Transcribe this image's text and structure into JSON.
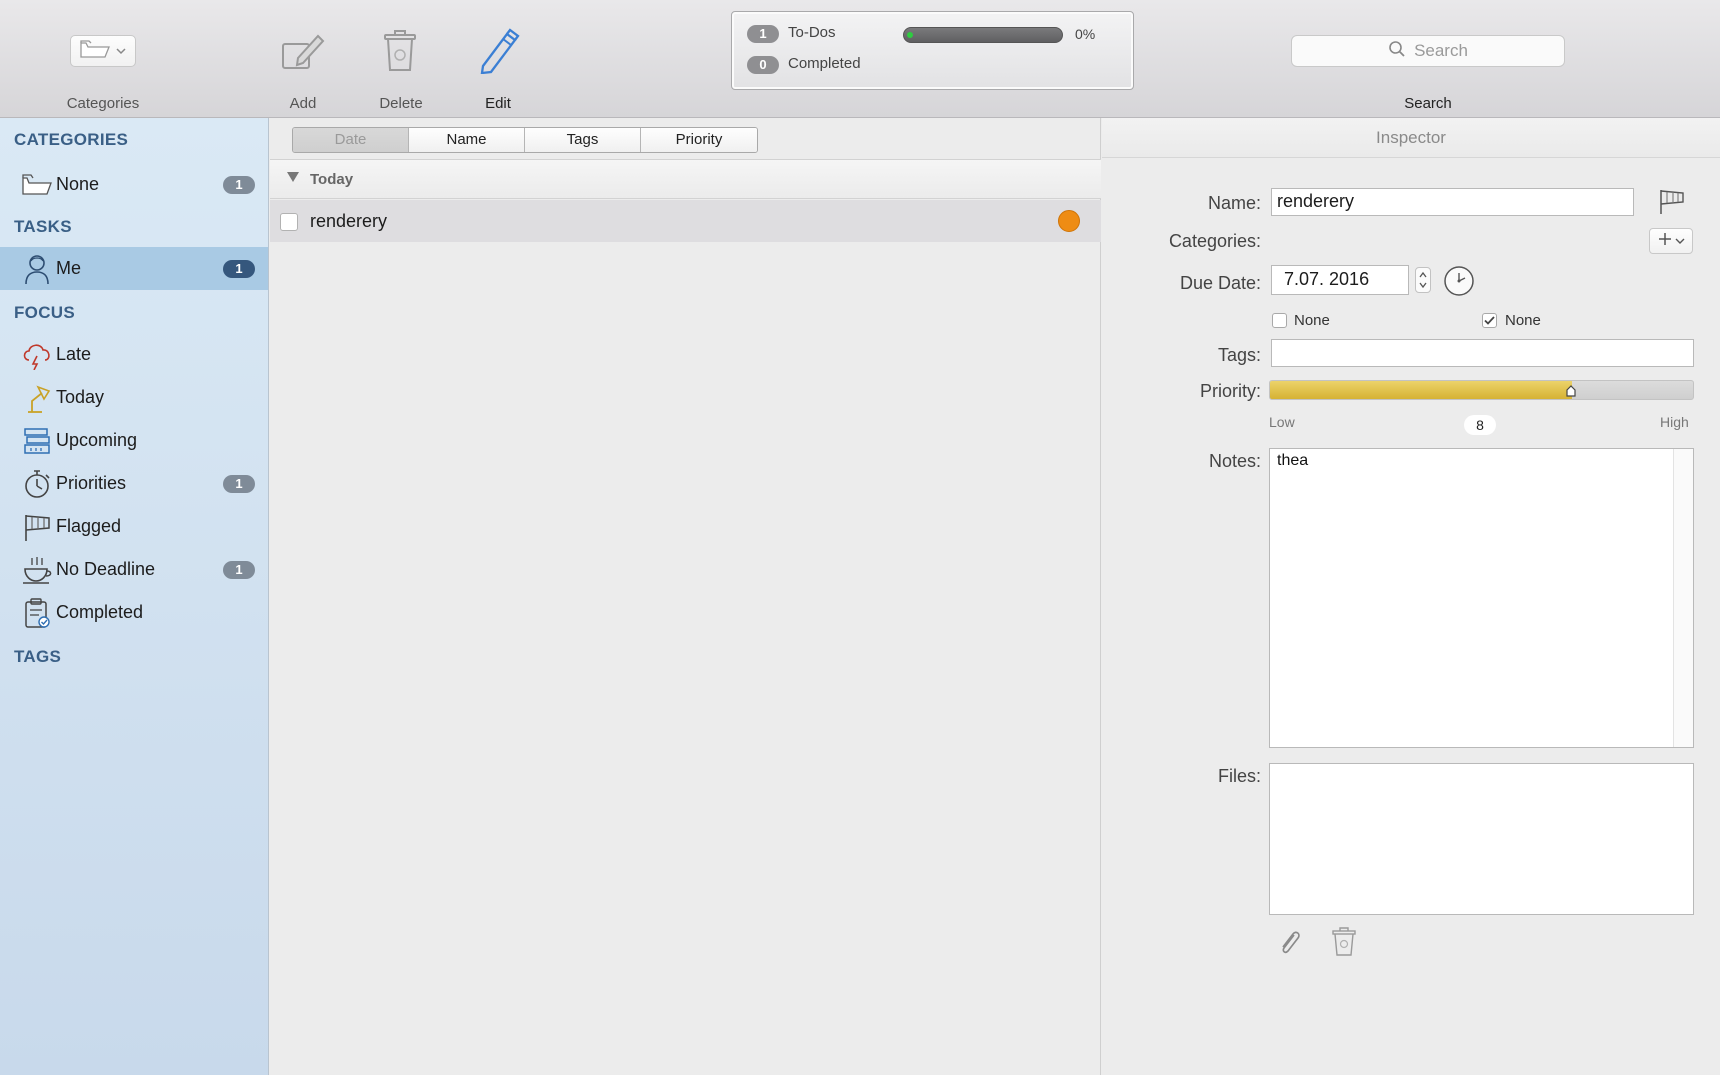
{
  "toolbar": {
    "categories_label": "Categories",
    "add_label": "Add",
    "delete_label": "Delete",
    "edit_label": "Edit",
    "search_label": "Search",
    "search_placeholder": "Search",
    "status": {
      "todos_count": "1",
      "todos_label": "To-Dos",
      "completed_count": "0",
      "completed_label": "Completed",
      "progress_text": "0%",
      "progress_fraction": 0
    }
  },
  "sidebar": {
    "categories_heading": "CATEGORIES",
    "tasks_heading": "TASKS",
    "focus_heading": "FOCUS",
    "tags_heading": "TAGS",
    "categories": [
      {
        "label": "None",
        "badge": "1",
        "icon": "folder-icon"
      }
    ],
    "tasks": [
      {
        "label": "Me",
        "badge": "1",
        "icon": "person-icon",
        "selected": true
      }
    ],
    "focus": [
      {
        "label": "Late",
        "badge": "",
        "icon": "storm-cloud-icon"
      },
      {
        "label": "Today",
        "badge": "",
        "icon": "desk-lamp-icon"
      },
      {
        "label": "Upcoming",
        "badge": "",
        "icon": "calendar-stack-icon"
      },
      {
        "label": "Priorities",
        "badge": "1",
        "icon": "stopwatch-icon"
      },
      {
        "label": "Flagged",
        "badge": "",
        "icon": "flag-icon"
      },
      {
        "label": "No Deadline",
        "badge": "1",
        "icon": "teacup-icon"
      },
      {
        "label": "Completed",
        "badge": "",
        "icon": "clipboard-check-icon"
      }
    ]
  },
  "list": {
    "sort_tabs": [
      "Date",
      "Name",
      "Tags",
      "Priority"
    ],
    "active_sort": "Date",
    "group_title": "Today",
    "tasks": [
      {
        "name": "renderery",
        "priority_color": "#ee8c14"
      }
    ]
  },
  "inspector": {
    "title": "Inspector",
    "name_label": "Name:",
    "name_value": "renderery",
    "categories_label": "Categories:",
    "due_label": "Due Date:",
    "due_value": "7.07. 2016",
    "none_1_label": "None",
    "none_2_label": "None",
    "tags_label": "Tags:",
    "tags_value": "",
    "priority_label": "Priority:",
    "priority_low": "Low",
    "priority_high": "High",
    "priority_value": "8",
    "priority_fraction": 0.71,
    "notes_label": "Notes:",
    "notes_value": "thea",
    "files_label": "Files:"
  },
  "colors": {
    "sidebar_selected": "#a9cae4",
    "heading": "#3a5f86",
    "edit_accent": "#3b7fd4",
    "priority_gold": "#d6b233",
    "task_dot": "#ee8c14"
  }
}
